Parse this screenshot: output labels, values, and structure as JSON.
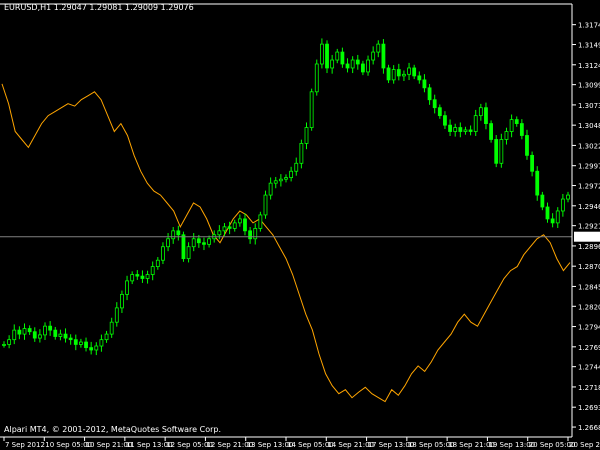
{
  "header": {
    "text": "EURUSD,H1  1.29047 1.29081 1.29009 1.29076"
  },
  "footer": {
    "text": "Alpari MT4, © 2001-2012, MetaQuotes Software Corp."
  },
  "colors": {
    "background": "#000000",
    "axis": "#ffffff",
    "candles": "#00ff00",
    "overlay": "#ffa500",
    "price_line": "#808080",
    "price_box_bg": "#ffffff",
    "price_box_text": "#000000"
  },
  "chart_data": {
    "type": "line",
    "symbol": "EURUSD",
    "timeframe": "H1",
    "current_price": "1.29076",
    "ylim": [
      1.2658,
      1.3198
    ],
    "y_tick_labels": [
      "1.31745",
      "1.31495",
      "1.31240",
      "1.30990",
      "1.30735",
      "1.30480",
      "1.30225",
      "1.29970",
      "1.29720",
      "1.29465",
      "1.29215",
      "1.28960",
      "1.28705",
      "1.28450",
      "1.28200",
      "1.27945",
      "1.27690",
      "1.27440",
      "1.27185",
      "1.26930",
      "1.26680"
    ],
    "x_tick_labels": [
      "7 Sep 2012",
      "10 Sep 05:00",
      "10 Sep 21:00",
      "11 Sep 13:00",
      "12 Sep 05:00",
      "12 Sep 21:00",
      "13 Sep 13:00",
      "14 Sep 05:00",
      "14 Sep 21:00",
      "17 Sep 13:00",
      "18 Sep 05:00",
      "18 Sep 21:00",
      "19 Sep 13:00",
      "20 Sep 05:00",
      "20 Sep 21:00"
    ],
    "series": [
      {
        "name": "EURUSD",
        "style": "candles",
        "values": [
          1.2772,
          1.2778,
          1.279,
          1.2785,
          1.2792,
          1.2788,
          1.278,
          1.2784,
          1.2795,
          1.279,
          1.2782,
          1.2785,
          1.278,
          1.2778,
          1.2772,
          1.2775,
          1.2768,
          1.2765,
          1.277,
          1.2778,
          1.2785,
          1.28,
          1.2818,
          1.2835,
          1.2852,
          1.286,
          1.2858,
          1.2855,
          1.286,
          1.287,
          1.2878,
          1.2895,
          1.2905,
          1.2915,
          1.291,
          1.288,
          1.2895,
          1.2905,
          1.29,
          1.2898,
          1.2905,
          1.291,
          1.2915,
          1.292,
          1.2918,
          1.2925,
          1.293,
          1.2915,
          1.2905,
          1.2918,
          1.2935,
          1.296,
          1.2975,
          1.2978,
          1.298,
          1.2982,
          1.299,
          1.3,
          1.3025,
          1.3045,
          1.309,
          1.3125,
          1.315,
          1.312,
          1.313,
          1.314,
          1.3125,
          1.312,
          1.313,
          1.3125,
          1.3115,
          1.313,
          1.314,
          1.315,
          1.312,
          1.3105,
          1.3118,
          1.311,
          1.3112,
          1.312,
          1.311,
          1.3105,
          1.3095,
          1.308,
          1.307,
          1.306,
          1.3048,
          1.304,
          1.3045,
          1.304,
          1.3042,
          1.304,
          1.306,
          1.307,
          1.305,
          1.303,
          1.3,
          1.303,
          1.304,
          1.3055,
          1.305,
          1.3035,
          1.301,
          1.299,
          1.296,
          1.2945,
          1.293,
          1.2925,
          1.294,
          1.2955,
          1.296
        ]
      },
      {
        "name": "",
        "style": "overlay",
        "values": [
          1.31,
          1.3075,
          1.304,
          1.303,
          1.302,
          1.3035,
          1.305,
          1.306,
          1.3065,
          1.307,
          1.3075,
          1.3072,
          1.308,
          1.3085,
          1.309,
          1.308,
          1.306,
          1.304,
          1.305,
          1.3035,
          1.301,
          1.299,
          1.2975,
          1.2965,
          1.296,
          1.295,
          1.294,
          1.292,
          1.2935,
          1.295,
          1.2945,
          1.293,
          1.291,
          1.29,
          1.2915,
          1.293,
          1.294,
          1.2935,
          1.2925,
          1.293,
          1.292,
          1.291,
          1.2895,
          1.288,
          1.286,
          1.2835,
          1.281,
          1.279,
          1.276,
          1.2735,
          1.272,
          1.271,
          1.2715,
          1.2705,
          1.2712,
          1.2718,
          1.271,
          1.2705,
          1.27,
          1.2715,
          1.2708,
          1.272,
          1.2735,
          1.2745,
          1.2738,
          1.275,
          1.2765,
          1.2775,
          1.2785,
          1.28,
          1.281,
          1.28,
          1.2795,
          1.281,
          1.2825,
          1.284,
          1.2855,
          1.2865,
          1.287,
          1.2885,
          1.2895,
          1.2905,
          1.291,
          1.29,
          1.288,
          1.2865,
          1.2875
        ]
      }
    ],
    "grid": false,
    "legend": "none"
  }
}
